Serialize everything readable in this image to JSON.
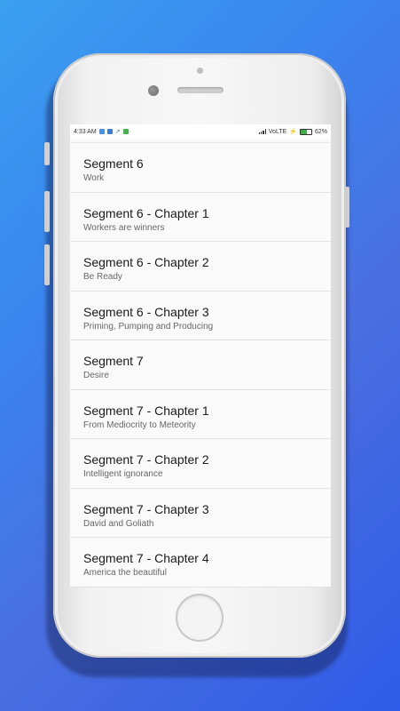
{
  "status_bar": {
    "time": "4:33 AM",
    "network": "VoLTE",
    "battery": "62%",
    "battery_level_pct": 62,
    "notification_icons": [
      "app-icon-blue",
      "app-icon-blue",
      "missed-call-icon",
      "message-icon-green"
    ]
  },
  "colors": {
    "background_start": "#3aa0f0",
    "background_end": "#2f5be8",
    "list_background": "#fafafa",
    "title_text": "#1a1a1a",
    "subtitle_text": "#666666"
  },
  "list": {
    "items": [
      {
        "title": "Segment 6",
        "subtitle": "Work"
      },
      {
        "title": "Segment 6 - Chapter 1",
        "subtitle": "Workers are winners"
      },
      {
        "title": "Segment 6 - Chapter 2",
        "subtitle": "Be Ready"
      },
      {
        "title": "Segment 6 - Chapter 3",
        "subtitle": "Priming, Pumping and Producing"
      },
      {
        "title": "Segment 7",
        "subtitle": "Desire"
      },
      {
        "title": "Segment 7 - Chapter 1",
        "subtitle": "From Mediocrity to Meteority"
      },
      {
        "title": "Segment 7 - Chapter 2",
        "subtitle": "Intelligent ignorance"
      },
      {
        "title": "Segment 7 - Chapter 3",
        "subtitle": "David and Goliath"
      },
      {
        "title": "Segment 7 - Chapter 4",
        "subtitle": "America the beautiful"
      }
    ]
  }
}
